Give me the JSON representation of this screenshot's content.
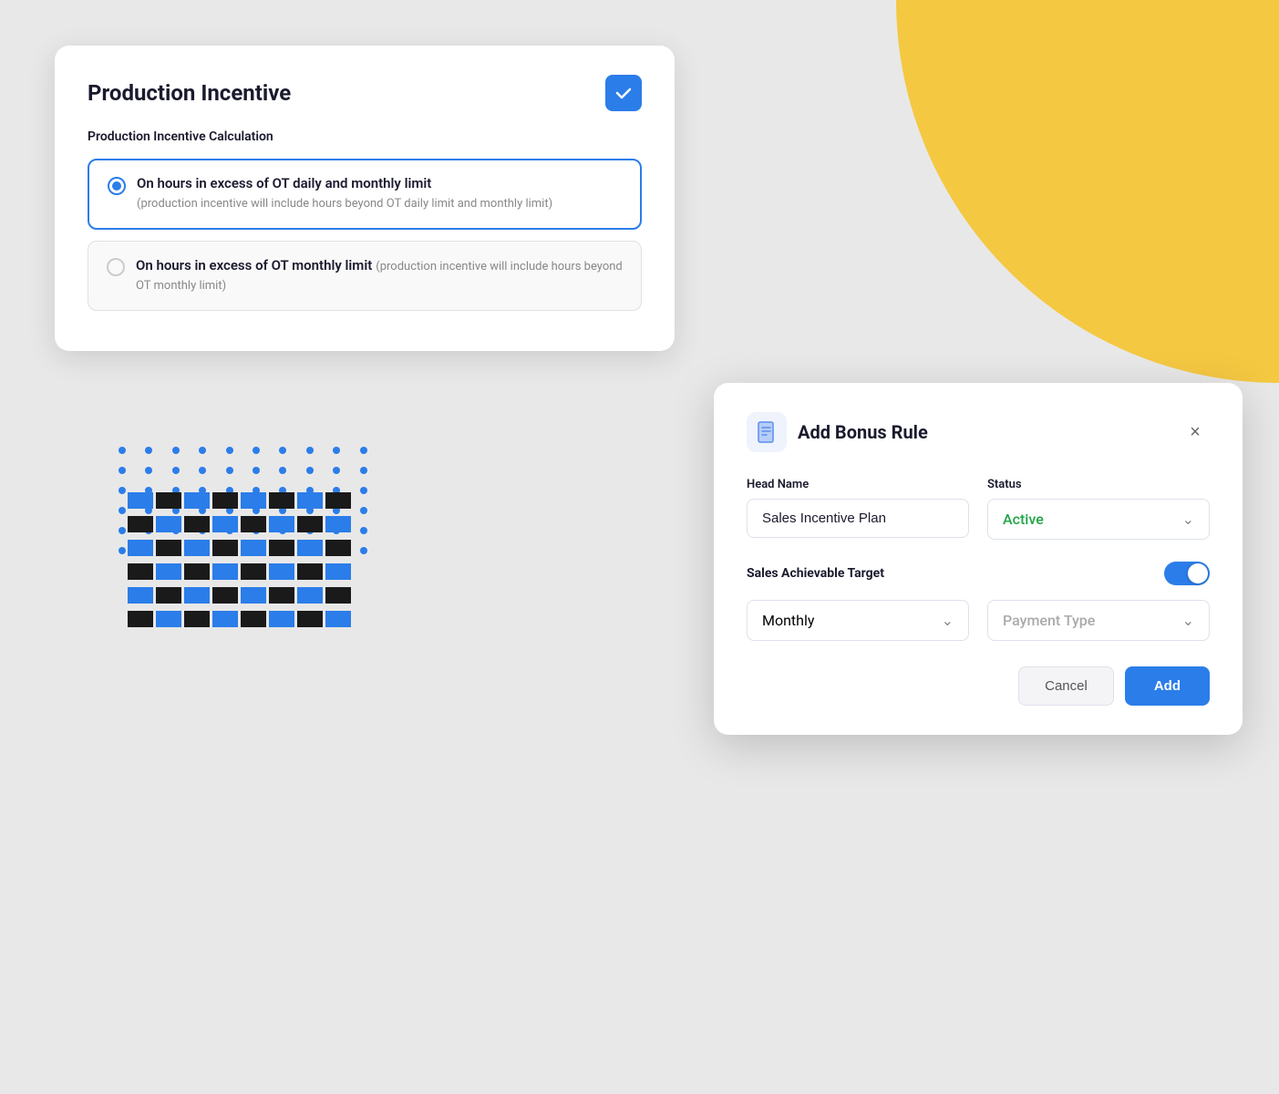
{
  "production_card": {
    "title": "Production Incentive",
    "subtitle": "Production Incentive Calculation",
    "option1": {
      "label": "On hours in excess of OT daily and monthly limit",
      "description": "(production incentive will include hours beyond OT daily limit and monthly limit)",
      "selected": true
    },
    "option2": {
      "label": "On hours in excess of OT monthly limit",
      "description": "(production incentive will include hours beyond OT monthly limit)",
      "selected": false
    }
  },
  "bonus_dialog": {
    "title": "Add Bonus Rule",
    "close_label": "×",
    "head_name_label": "Head Name",
    "head_name_value": "Sales Incentive Plan",
    "head_name_placeholder": "Sales Incentive Plan",
    "status_label": "Status",
    "status_value": "Active",
    "sales_target_label": "Sales Achievable Target",
    "monthly_value": "Monthly",
    "payment_type_placeholder": "Payment Type",
    "cancel_label": "Cancel",
    "add_label": "Add"
  },
  "icons": {
    "check": "✓",
    "chevron_down": "⌄",
    "close": "×",
    "bonus_rule": "📋"
  }
}
